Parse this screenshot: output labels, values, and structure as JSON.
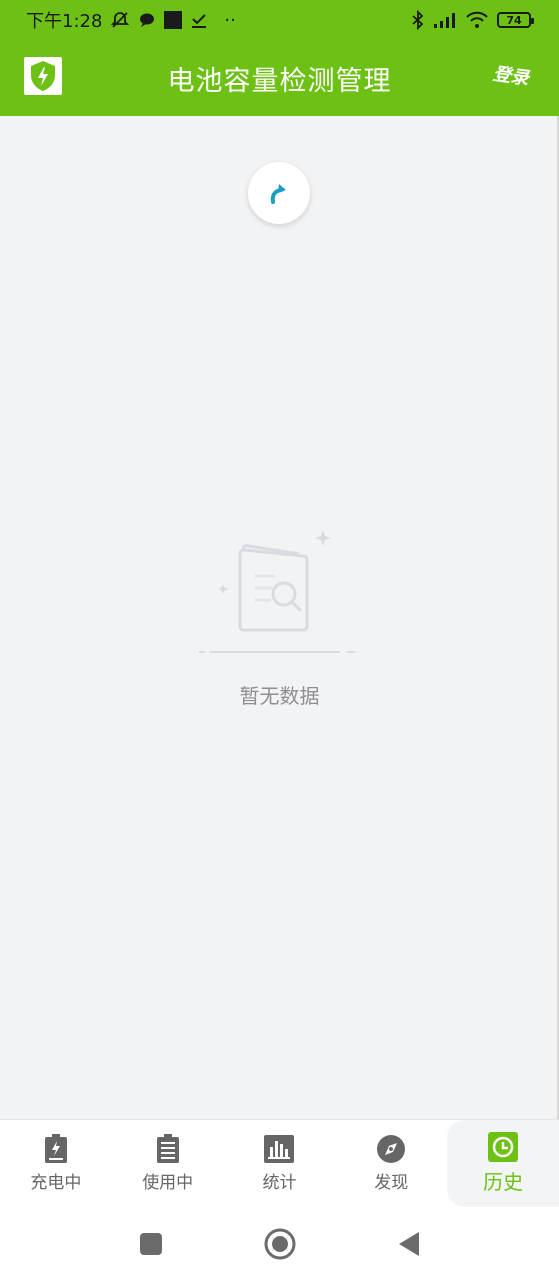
{
  "status_bar": {
    "time": "下午1:28",
    "battery_level": "74",
    "extra_dots": "··"
  },
  "header": {
    "title": "电池容量检测管理",
    "login_label": "登录"
  },
  "empty_state": {
    "message": "暂无数据"
  },
  "bottom_nav": {
    "items": [
      {
        "label": "充电中",
        "icon": "battery-charging-icon"
      },
      {
        "label": "使用中",
        "icon": "battery-full-icon"
      },
      {
        "label": "统计",
        "icon": "bar-chart-icon"
      },
      {
        "label": "发现",
        "icon": "compass-icon"
      },
      {
        "label": "历史",
        "icon": "clock-icon"
      }
    ],
    "active_index": 4
  },
  "colors": {
    "brand": "#6cc114",
    "background": "#f2f3f5",
    "refresh_arrow": "#1a9fbf"
  }
}
